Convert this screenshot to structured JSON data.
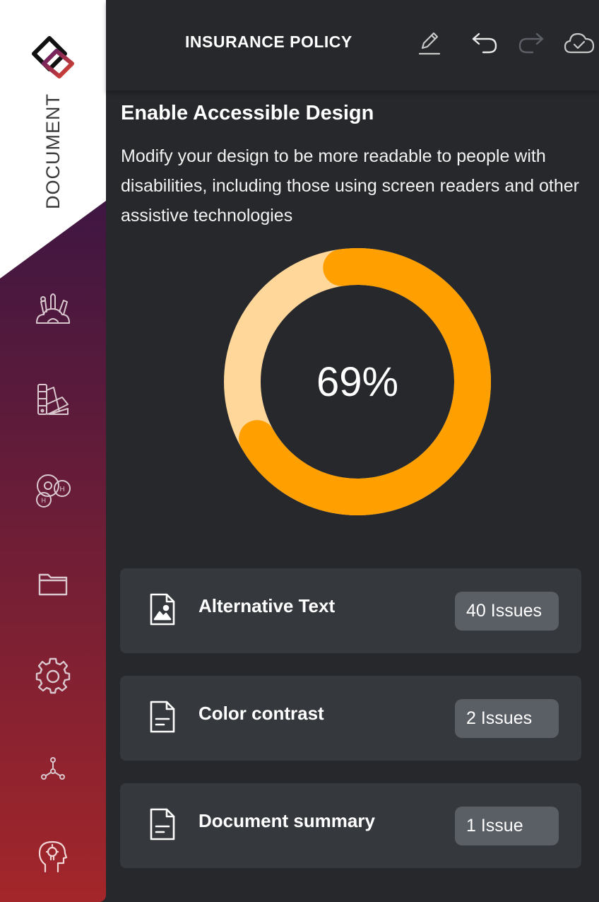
{
  "sidebar": {
    "brand": "DOCUMENT",
    "colors": {
      "top": "#ffffff",
      "gradient_start": "#3e1642",
      "gradient_end": "#a3262a"
    },
    "items": [
      {
        "icon": "art-supplies-icon"
      },
      {
        "icon": "color-swatches-icon"
      },
      {
        "icon": "font-discs-icon"
      },
      {
        "icon": "folder-icon"
      },
      {
        "icon": "gear-icon"
      },
      {
        "icon": "network-nodes-icon"
      },
      {
        "icon": "lightbulb-head-icon"
      }
    ]
  },
  "header": {
    "title": "INSURANCE POLICY",
    "tools": [
      "edit-icon",
      "undo-icon",
      "redo-icon",
      "cloud-saved-icon"
    ]
  },
  "content": {
    "title": "Enable Accessible Design",
    "description": "Modify your design to be more readable to people with disabilities, including those using screen readers and other assistive technologies"
  },
  "progress": {
    "label": "69%",
    "value": 0.69,
    "colors": {
      "fill": "#ff9f00",
      "track": "#ffd79b"
    }
  },
  "issues": [
    {
      "label": "Alternative Text",
      "badge": "40 Issues",
      "icon": "image-file-icon"
    },
    {
      "label": "Color contrast",
      "badge": "2 Issues",
      "icon": "text-file-icon"
    },
    {
      "label": "Document summary",
      "badge": "1 Issue",
      "icon": "text-file-icon"
    }
  ]
}
